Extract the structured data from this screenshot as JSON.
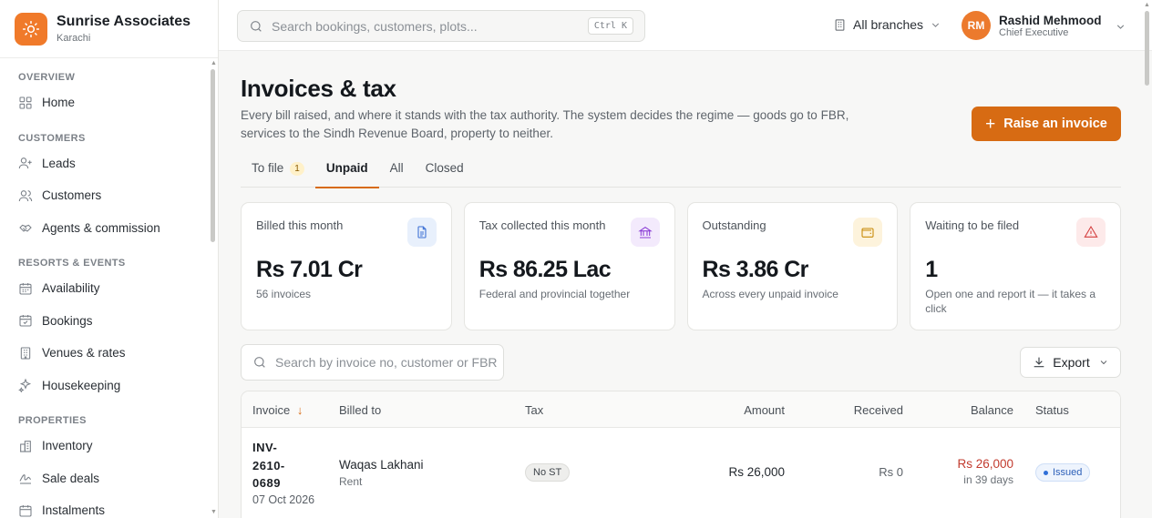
{
  "brand": {
    "name": "Sunrise Associates",
    "city": "Karachi",
    "icon": "sun-icon",
    "color": "#f07a2a"
  },
  "nav": {
    "sections": [
      {
        "title": "OVERVIEW",
        "items": [
          {
            "label": "Home",
            "icon": "grid-icon"
          }
        ]
      },
      {
        "title": "CUSTOMERS",
        "items": [
          {
            "label": "Leads",
            "icon": "user-plus-icon"
          },
          {
            "label": "Customers",
            "icon": "users-icon"
          },
          {
            "label": "Agents & commission",
            "icon": "handshake-icon"
          }
        ]
      },
      {
        "title": "RESORTS & EVENTS",
        "items": [
          {
            "label": "Availability",
            "icon": "calendar-icon"
          },
          {
            "label": "Bookings",
            "icon": "calendar-check-icon"
          },
          {
            "label": "Venues & rates",
            "icon": "building-icon"
          },
          {
            "label": "Housekeeping",
            "icon": "sparkle-icon"
          }
        ]
      },
      {
        "title": "PROPERTIES",
        "items": [
          {
            "label": "Inventory",
            "icon": "building-2-icon"
          },
          {
            "label": "Sale deals",
            "icon": "signature-icon"
          },
          {
            "label": "Instalments",
            "icon": "calendar-clock-icon"
          }
        ]
      }
    ]
  },
  "topbar": {
    "search_placeholder": "Search bookings, customers, plots...",
    "shortcut": "Ctrl K",
    "branches": "All branches",
    "user": {
      "initials": "RM",
      "name": "Rashid Mehmood",
      "role": "Chief Executive"
    }
  },
  "page": {
    "title": "Invoices & tax",
    "subtitle": "Every bill raised, and where it stands with the tax authority. The system decides the regime — goods go to FBR, services to the Sindh Revenue Board, property to neither.",
    "cta": "Raise an invoice",
    "accent": "#d76b13"
  },
  "tabs": [
    {
      "label": "To file",
      "count": "1"
    },
    {
      "label": "Unpaid",
      "count": ""
    },
    {
      "label": "All",
      "count": ""
    },
    {
      "label": "Closed",
      "count": ""
    }
  ],
  "active_tab": "Unpaid",
  "cards": [
    {
      "label": "Billed this month",
      "value": "Rs 7.01 Cr",
      "sub": "56 invoices",
      "icon": "file-text-icon",
      "icon_color": "#3b6fd4",
      "icon_bg": "#e8f0fc"
    },
    {
      "label": "Tax collected this month",
      "value": "Rs 86.25 Lac",
      "sub": "Federal and provincial together",
      "icon": "landmark-icon",
      "icon_color": "#8c3fd6",
      "icon_bg": "#f3eafc"
    },
    {
      "label": "Outstanding",
      "value": "Rs 3.86 Cr",
      "sub": "Across every unpaid invoice",
      "icon": "wallet-icon",
      "icon_color": "#c88a06",
      "icon_bg": "#fdf3dc"
    },
    {
      "label": "Waiting to be filed",
      "value": "1",
      "sub": "Open one and report it — it takes a click",
      "icon": "alert-triangle-icon",
      "icon_color": "#d43d3d",
      "icon_bg": "#fdeaea"
    }
  ],
  "table": {
    "search_placeholder": "Search by invoice no, customer or FBR",
    "export": "Export",
    "columns": [
      "Invoice",
      "Billed to",
      "Tax",
      "Amount",
      "Received",
      "Balance",
      "Status"
    ],
    "rows": [
      {
        "invoice_lines": [
          "INV-",
          "2610-",
          "0689"
        ],
        "date": "07 Oct 2026",
        "customer": "Waqas Lakhani",
        "type": "Rent",
        "tax": "No ST",
        "amount": "Rs 26,000",
        "received": "Rs 0",
        "balance": "Rs 26,000",
        "due": "in 39 days",
        "status": "Issued"
      }
    ]
  }
}
